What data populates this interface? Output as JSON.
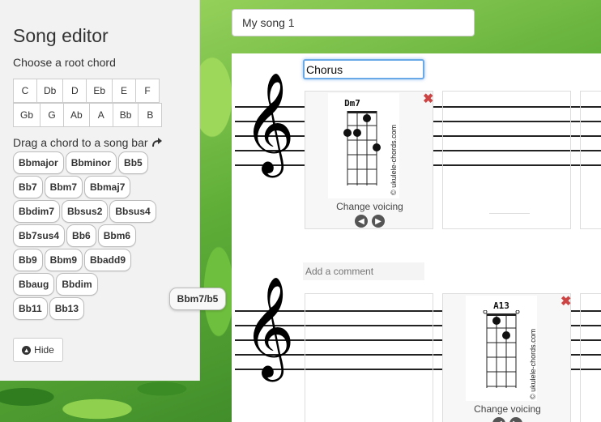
{
  "editor": {
    "title": "Song editor",
    "root_label": "Choose a root chord",
    "root_rows": [
      [
        "C",
        "Db",
        "D",
        "Eb",
        "E",
        "F"
      ],
      [
        "Gb",
        "G",
        "Ab",
        "A",
        "Bb",
        "B"
      ]
    ],
    "drag_label": "Drag a chord to a song bar",
    "chord_rows": [
      [
        "Bbmajor",
        "Bbminor",
        "Bb5"
      ],
      [
        "Bb7",
        "Bbm7",
        "Bbmaj7"
      ],
      [
        "Bbdim7",
        "Bbsus2",
        "Bbsus4"
      ],
      [
        "Bb7sus4",
        "Bb6",
        "Bbm6"
      ],
      [
        "Bb9",
        "Bbm9",
        "Bbadd9"
      ],
      [
        "Bbaug",
        "Bbdim"
      ],
      [
        "Bb11",
        "Bb13"
      ]
    ],
    "dragging_chord": "Bbm7/b5",
    "hide_label": "Hide"
  },
  "song": {
    "title_value": "My song 1",
    "section_value": "Chorus",
    "comment_placeholder": "Add a comment",
    "change_voicing_label": "Change voicing",
    "credit_text": "© ukulele-chords.com",
    "bars": [
      {
        "chord": "Dm7"
      },
      {
        "chord": ""
      },
      {
        "chord": ""
      },
      {
        "chord": "A13"
      }
    ]
  },
  "icons": {
    "arrow": "right-curved-arrow-icon",
    "hide": "arrow-up-circle-icon",
    "close": "close-x-icon",
    "prev": "arrow-left-circle-icon",
    "next": "arrow-right-circle-icon",
    "clef": "treble-clef-icon"
  },
  "colors": {
    "close_red": "#c44444",
    "focus_blue": "#6aa9e8"
  }
}
